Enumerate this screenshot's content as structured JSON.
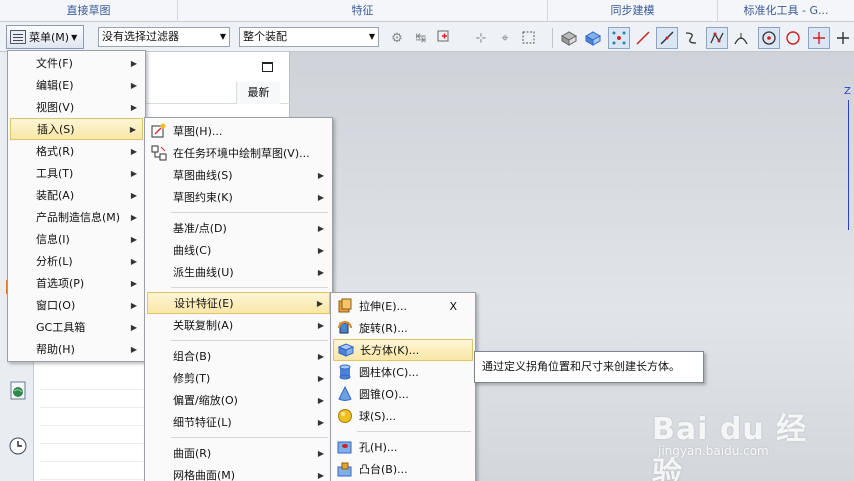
{
  "ribbon": {
    "groups": [
      "直接草图",
      "特征",
      "同步建模",
      "标准化工具 - G..."
    ]
  },
  "toolbar": {
    "menu_label": "菜单(M)",
    "filter_value": "没有选择过滤器",
    "assembly_value": "整个装配"
  },
  "nav_panel": {
    "column_header": "最新"
  },
  "main_menu": {
    "items": [
      {
        "label": "文件(F)"
      },
      {
        "label": "编辑(E)"
      },
      {
        "label": "视图(V)"
      },
      {
        "label": "插入(S)"
      },
      {
        "label": "格式(R)"
      },
      {
        "label": "工具(T)"
      },
      {
        "label": "装配(A)"
      },
      {
        "label": "产品制造信息(M)"
      },
      {
        "label": "信息(I)"
      },
      {
        "label": "分析(L)"
      },
      {
        "label": "首选项(P)"
      },
      {
        "label": "窗口(O)"
      },
      {
        "label": "GC工具箱"
      },
      {
        "label": "帮助(H)"
      }
    ]
  },
  "insert_menu": {
    "items": [
      {
        "label": "草图(H)..."
      },
      {
        "label": "在任务环境中绘制草图(V)..."
      },
      {
        "label": "草图曲线(S)"
      },
      {
        "label": "草图约束(K)"
      },
      {
        "label": "基准/点(D)"
      },
      {
        "label": "曲线(C)"
      },
      {
        "label": "派生曲线(U)"
      },
      {
        "label": "设计特征(E)"
      },
      {
        "label": "关联复制(A)"
      },
      {
        "label": "组合(B)"
      },
      {
        "label": "修剪(T)"
      },
      {
        "label": "偏置/缩放(O)"
      },
      {
        "label": "细节特征(L)"
      },
      {
        "label": "曲面(R)"
      },
      {
        "label": "网格曲面(M)"
      }
    ]
  },
  "design_menu": {
    "items": [
      {
        "label": "拉伸(E)...",
        "shortcut": "X"
      },
      {
        "label": "旋转(R)..."
      },
      {
        "label": "长方体(K)..."
      },
      {
        "label": "圆柱体(C)..."
      },
      {
        "label": "圆锥(O)..."
      },
      {
        "label": "球(S)..."
      },
      {
        "label": "孔(H)..."
      },
      {
        "label": "凸台(B)..."
      }
    ]
  },
  "tooltip": {
    "text": "通过定义拐角位置和尺寸来创建长方体。"
  },
  "viewport": {
    "axis_label": "Z"
  },
  "watermark": {
    "brand": "Bai du 经验",
    "url": "jingyan.baidu.com"
  }
}
